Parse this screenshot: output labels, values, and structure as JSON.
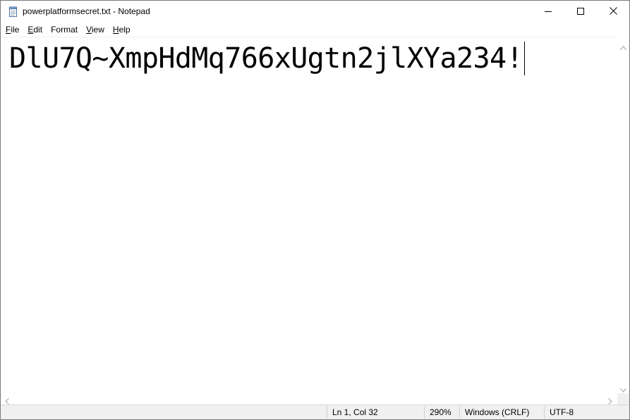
{
  "window": {
    "title": "powerplatformsecret.txt - Notepad",
    "app_icon": "notepad-icon"
  },
  "caption_buttons": {
    "minimize_icon": "minimize-icon",
    "maximize_icon": "maximize-icon",
    "close_icon": "close-icon"
  },
  "menu": {
    "items": [
      {
        "label": "File",
        "accel": "F",
        "rest": "ile"
      },
      {
        "label": "Edit",
        "accel": "E",
        "rest": "dit"
      },
      {
        "label": "Format",
        "accel": "F",
        "rest": "ormat",
        "prefix": ""
      },
      {
        "label": "View",
        "accel": "V",
        "rest": "iew"
      },
      {
        "label": "Help",
        "accel": "H",
        "rest": "elp"
      }
    ]
  },
  "editor": {
    "content": "DlU7Q~XmpHdMq766xUgtn2jlXYa234!"
  },
  "status": {
    "position": "Ln 1, Col 32",
    "zoom": "290%",
    "line_ending": "Windows (CRLF)",
    "encoding": "UTF-8"
  },
  "colors": {
    "statusbar_bg": "#f0f0f0",
    "text": "#000000"
  }
}
